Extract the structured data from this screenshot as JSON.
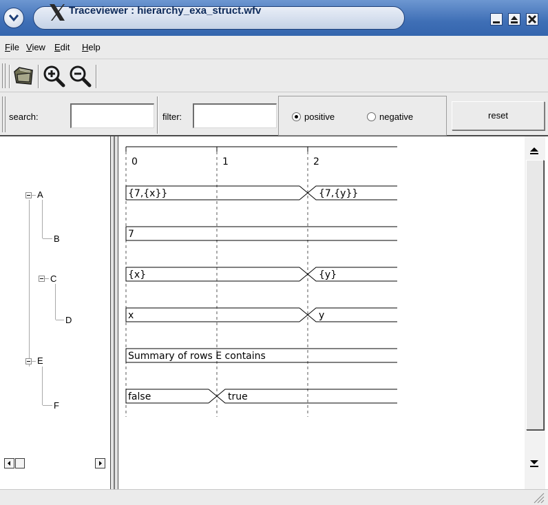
{
  "window": {
    "title": "Traceviewer : hierarchy_exa_struct.wfv",
    "title_color": "#3465ad"
  },
  "menubar": {
    "items": [
      {
        "label": "File",
        "mnemonic": "F",
        "rest": "ile"
      },
      {
        "label": "View",
        "mnemonic": "V",
        "rest": "iew"
      },
      {
        "label": "Edit",
        "mnemonic": "E",
        "rest": "dit"
      },
      {
        "label": "Help",
        "mnemonic": "H",
        "rest": "elp"
      }
    ]
  },
  "toolbar": {
    "icons": [
      "open-folder-icon",
      "zoom-in-icon",
      "zoom-out-icon"
    ]
  },
  "searchbar": {
    "search_label": "search:",
    "search_value": "",
    "filter_label": "filter:",
    "filter_value": "",
    "radio_positive_label": "positive",
    "radio_negative_label": "negative",
    "selected": "positive",
    "reset_label": "reset"
  },
  "tree": {
    "nodes": [
      {
        "label": "A",
        "expanded": true
      },
      {
        "label": "B"
      },
      {
        "label": "C",
        "expanded": true
      },
      {
        "label": "D"
      },
      {
        "label": "E",
        "expanded": true
      },
      {
        "label": "F"
      }
    ]
  },
  "waveform": {
    "time_ticks": [
      "0",
      "1",
      "2"
    ],
    "signals": [
      {
        "name": "A",
        "segments": [
          {
            "from": 0,
            "to": 2,
            "value": "{7,{x}}"
          },
          {
            "from": 2,
            "to": 3,
            "value": "{7,{y}}"
          }
        ]
      },
      {
        "name": "B",
        "segments": [
          {
            "from": 0,
            "to": 3,
            "value": "7"
          }
        ]
      },
      {
        "name": "C",
        "segments": [
          {
            "from": 0,
            "to": 2,
            "value": "{x}"
          },
          {
            "from": 2,
            "to": 3,
            "value": "{y}"
          }
        ]
      },
      {
        "name": "D",
        "segments": [
          {
            "from": 0,
            "to": 2,
            "value": "x"
          },
          {
            "from": 2,
            "to": 3,
            "value": "y"
          }
        ]
      },
      {
        "name": "E",
        "segments": [
          {
            "from": 0,
            "to": 3,
            "value": "Summary of rows E contains"
          }
        ]
      },
      {
        "name": "F",
        "segments": [
          {
            "from": 0,
            "to": 1,
            "value": "false"
          },
          {
            "from": 1,
            "to": 3,
            "value": "true"
          }
        ]
      }
    ]
  }
}
